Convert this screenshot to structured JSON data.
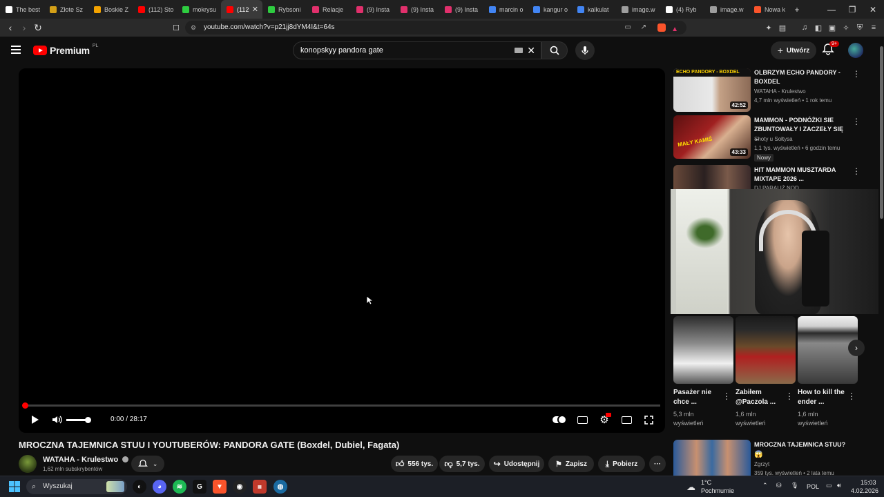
{
  "browser": {
    "tabs": [
      {
        "label": "The best",
        "color": "#ffffff"
      },
      {
        "label": "Złote Sz",
        "color": "#d4a017"
      },
      {
        "label": "Boskie Z",
        "color": "#f4a300"
      },
      {
        "label": "(112) Sto",
        "color": "#ff0000"
      },
      {
        "label": "mokrysu",
        "color": "#2ecc40"
      },
      {
        "label": "(112",
        "color": "#ff0000"
      },
      {
        "label": "Rybsoni",
        "color": "#2ecc40"
      },
      {
        "label": "Relacje",
        "color": "#e1306c"
      },
      {
        "label": "(9) Insta",
        "color": "#e1306c"
      },
      {
        "label": "(9) Insta",
        "color": "#e1306c"
      },
      {
        "label": "(9) Insta",
        "color": "#e1306c"
      },
      {
        "label": "marcin o",
        "color": "#4285f4"
      },
      {
        "label": "kangur o",
        "color": "#4285f4"
      },
      {
        "label": "kalkulat",
        "color": "#4285f4"
      },
      {
        "label": "image.w",
        "color": "#9e9e9e"
      },
      {
        "label": "(4) Ryb",
        "color": "#ffffff"
      },
      {
        "label": "image.w",
        "color": "#9e9e9e"
      },
      {
        "label": "Nowa k",
        "color": "#fb542b"
      }
    ],
    "active_tab_index": 5,
    "url": "youtube.com/watch?v=p21jj8dYM4I&t=64s"
  },
  "youtube": {
    "logo_text": "Premium",
    "logo_region": "PL",
    "search_query": "konopskyy pandora gate",
    "create_label": "Utwórz",
    "notification_badge": "9+"
  },
  "player": {
    "time": "0:00 / 28:17",
    "progress": 0.0,
    "volume": 1.0
  },
  "video": {
    "title": "MROCZNA TAJEMNICA STUU I YOUTUBERÓW: PANDORA GATE (Boxdel, Dubiel, Fagata)",
    "channel": "WATAHA - Krulestwo",
    "subscribers": "1,62 mln subskrybentów",
    "likes": "556 tys.",
    "dislikes": "5,7 tys.",
    "share_label": "Udostępnij",
    "save_label": "Zapisz",
    "download_label": "Pobierz"
  },
  "related": [
    {
      "title": "OLBRZYM ECHO PANDORY - BOXDEL",
      "channel": "WATAHA - Krulestwo",
      "meta": "4,7 mln wyświetleń • 1 rok temu",
      "duration": "42:52",
      "thumb_text": "ECHO PANDORY - BOXDEL"
    },
    {
      "title": "MAMMON - PODNÓŻKI SIE ZBUNTOWAŁY I ZACZEŁY SIĘ ...",
      "channel": "Shoty u Sołtysa",
      "meta": "1,1 tys. wyświetleń • 6 godzin temu",
      "duration": "43:33",
      "badge": "Nowy",
      "thumb_text": "MAŁY KAMIŚ"
    },
    {
      "title": "HIT MAMMON MUSZTARDA MIXTAPE 2026 ...",
      "channel": "DJ PARALIŻ NOD",
      "meta": "",
      "duration": ""
    },
    {
      "title": "MROCZNA TAJEMNICA STUU?",
      "channel": "Zgrzyt",
      "meta": "359 tys. wyświetleń • 2 lata temu",
      "duration": ""
    }
  ],
  "shorts": [
    {
      "title": "Pasażer nie chce ...",
      "views": "5,3 mln wyświetleń"
    },
    {
      "title": "Zabiłem @Paczola ...",
      "views": "1,6 mln wyświetleń"
    },
    {
      "title": "How to kill the ender ...",
      "views": "1,6 mln wyświetleń"
    }
  ],
  "taskbar": {
    "search_placeholder": "Wyszukaj",
    "weather_temp": "1°C",
    "weather_desc": "Pochmurnie",
    "lang": "POL",
    "time": "15:03",
    "date": "4.02.2026"
  },
  "colors": {
    "yt_red": "#ff0000",
    "background": "#0f0f0f"
  }
}
